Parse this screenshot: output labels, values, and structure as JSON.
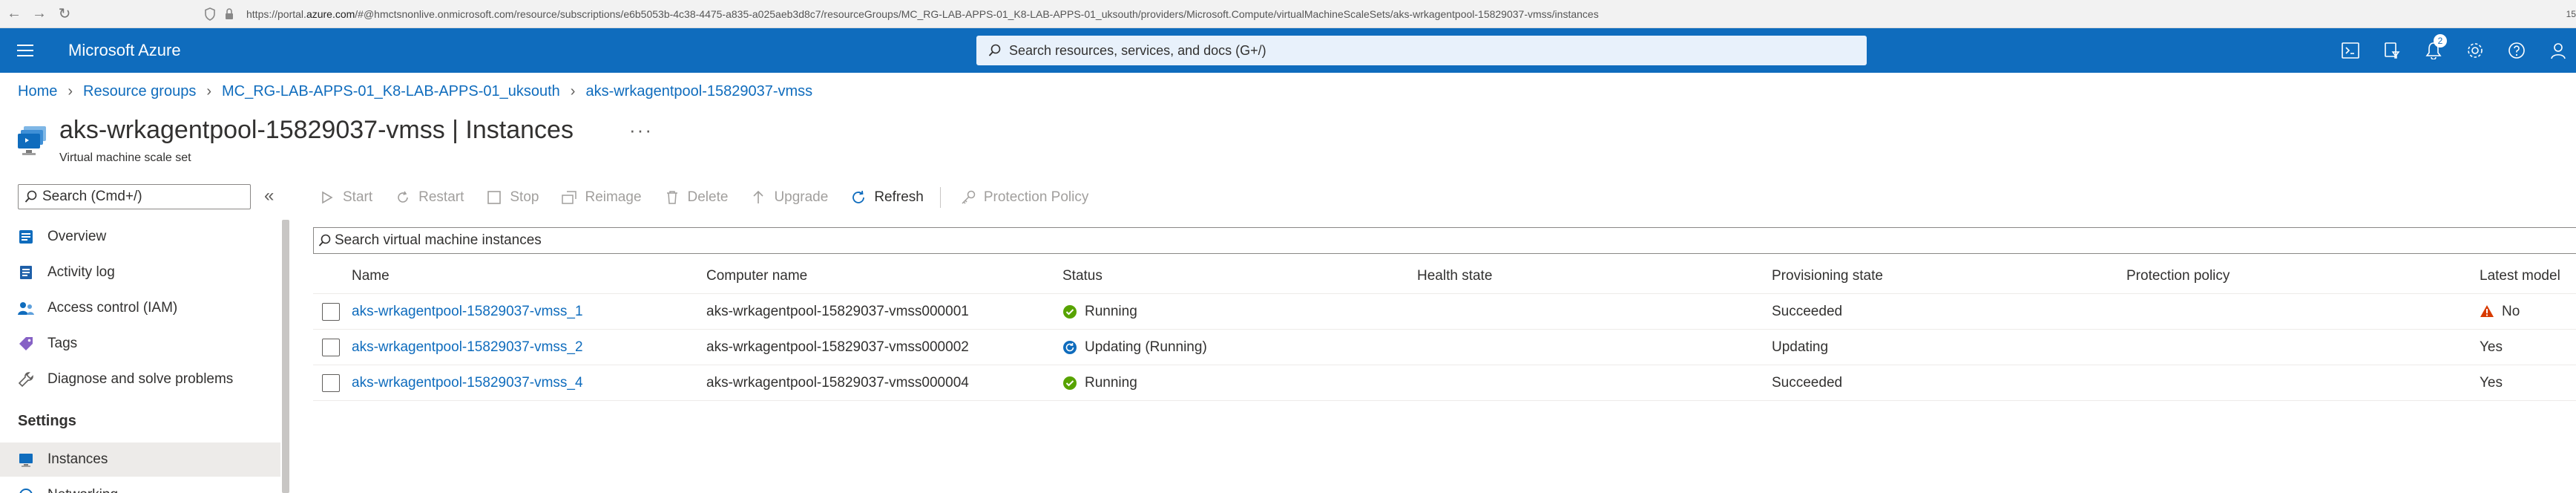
{
  "browser": {
    "url_prefix": "https://portal.",
    "url_domain": "azure.com",
    "url_rest": "/#@hmctsnonlive.onmicrosoft.com/resource/subscriptions/e6b5053b-4c38-4475-a835-a025aeb3d8c7/resourceGroups/MC_RG-LAB-APPS-01_K8-LAB-APPS-01_uksouth/providers/Microsoft.Compute/virtualMachineScaleSets/aks-wrkagentpool-15829037-vmss/instances",
    "right_text": "15"
  },
  "topbar": {
    "brand": "Microsoft Azure",
    "search_placeholder": "Search resources, services, and docs (G+/)",
    "notification_count": "2"
  },
  "breadcrumb": [
    "Home",
    "Resource groups",
    "MC_RG-LAB-APPS-01_K8-LAB-APPS-01_uksouth",
    "aks-wrkagentpool-15829037-vmss"
  ],
  "header": {
    "title": "aks-wrkagentpool-15829037-vmss | Instances",
    "subtitle": "Virtual machine scale set",
    "more": "···"
  },
  "sidebar": {
    "search_placeholder": "Search (Cmd+/)",
    "collapse": "«",
    "items": [
      {
        "label": "Overview",
        "icon": "overview-icon"
      },
      {
        "label": "Activity log",
        "icon": "activity-log-icon"
      },
      {
        "label": "Access control (IAM)",
        "icon": "iam-icon"
      },
      {
        "label": "Tags",
        "icon": "tag-icon"
      },
      {
        "label": "Diagnose and solve problems",
        "icon": "wrench-icon"
      }
    ],
    "settings_heading": "Settings",
    "settings_items": [
      {
        "label": "Instances",
        "icon": "instances-icon",
        "active": true
      },
      {
        "label": "Networking",
        "icon": "networking-icon"
      }
    ]
  },
  "toolbar": {
    "start": "Start",
    "restart": "Restart",
    "stop": "Stop",
    "reimage": "Reimage",
    "delete": "Delete",
    "upgrade": "Upgrade",
    "refresh": "Refresh",
    "protection_policy": "Protection Policy"
  },
  "grid": {
    "search_placeholder": "Search virtual machine instances",
    "columns": [
      "Name",
      "Computer name",
      "Status",
      "Health state",
      "Provisioning state",
      "Protection policy",
      "Latest model"
    ],
    "rows": [
      {
        "name": "aks-wrkagentpool-15829037-vmss_1",
        "computer": "aks-wrkagentpool-15829037-vmss000001",
        "status": "Running",
        "status_icon": "check-circle-icon",
        "health": "",
        "provisioning": "Succeeded",
        "protection": "",
        "latest": "No",
        "latest_icon": "warning-icon"
      },
      {
        "name": "aks-wrkagentpool-15829037-vmss_2",
        "computer": "aks-wrkagentpool-15829037-vmss000002",
        "status": "Updating (Running)",
        "status_icon": "updating-icon",
        "health": "",
        "provisioning": "Updating",
        "protection": "",
        "latest": "Yes",
        "latest_icon": ""
      },
      {
        "name": "aks-wrkagentpool-15829037-vmss_4",
        "computer": "aks-wrkagentpool-15829037-vmss000004",
        "status": "Running",
        "status_icon": "check-circle-icon",
        "health": "",
        "provisioning": "Succeeded",
        "protection": "",
        "latest": "Yes",
        "latest_icon": ""
      }
    ]
  },
  "colors": {
    "azure_blue": "#0f6cbd",
    "success_green": "#57a300",
    "warning_orange": "#d83b01"
  }
}
